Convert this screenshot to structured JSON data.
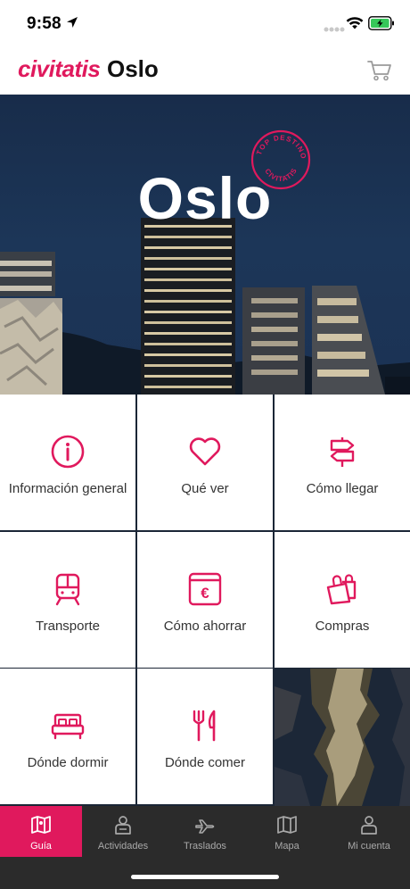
{
  "status_bar": {
    "time": "9:58"
  },
  "header": {
    "brand": "civitatis",
    "city": "Oslo"
  },
  "hero": {
    "title": "Oslo",
    "badge_top": "TOP DESTINOS",
    "badge_bottom": "CIVITATIS"
  },
  "grid": {
    "items": [
      {
        "label": "Información general",
        "icon": "info-icon"
      },
      {
        "label": "Qué ver",
        "icon": "heart-icon"
      },
      {
        "label": "Cómo llegar",
        "icon": "signpost-icon"
      },
      {
        "label": "Transporte",
        "icon": "train-icon"
      },
      {
        "label": "Cómo ahorrar",
        "icon": "euro-wallet-icon"
      },
      {
        "label": "Compras",
        "icon": "shopping-bags-icon"
      },
      {
        "label": "Dónde dormir",
        "icon": "bed-icon"
      },
      {
        "label": "Dónde comer",
        "icon": "cutlery-icon"
      }
    ]
  },
  "tabs": [
    {
      "label": "Guía",
      "icon": "map-icon",
      "active": true
    },
    {
      "label": "Actividades",
      "icon": "guide-person-icon",
      "active": false
    },
    {
      "label": "Traslados",
      "icon": "plane-icon",
      "active": false
    },
    {
      "label": "Mapa",
      "icon": "map-outline-icon",
      "active": false
    },
    {
      "label": "Mi cuenta",
      "icon": "user-icon",
      "active": false
    }
  ],
  "colors": {
    "accent": "#e0195d",
    "tabbar": "#2b2b2b",
    "hero_sky": "#1c3658"
  }
}
